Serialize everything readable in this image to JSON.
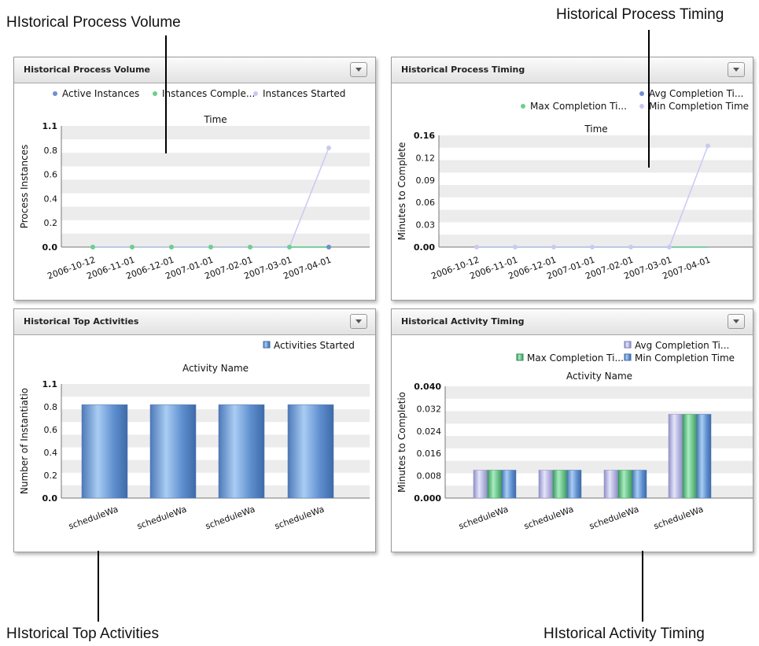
{
  "callouts": {
    "volume": "HIstorical Process Volume",
    "timing": "Historical Process Timing",
    "top_activities": "HIstorical Top Activities",
    "activity_timing": "HIstorical Activity Timing"
  },
  "panels": {
    "volume": {
      "title": "Historical Process Volume",
      "legend": [
        "Active Instances",
        "Instances Comple...",
        "Instances Started"
      ]
    },
    "timing": {
      "title": "Historical Process Timing",
      "legend": [
        "Avg Completion Ti...",
        "Max Completion Ti...",
        "Min Completion Time"
      ]
    },
    "top": {
      "title": "Historical Top Activities",
      "legend": [
        "Activities Started"
      ]
    },
    "acttiming": {
      "title": "Historical Activity Timing",
      "legend": [
        "Avg Completion Ti...",
        "Max Completion Ti...",
        "Min Completion Time"
      ]
    }
  },
  "chart_data": [
    {
      "type": "line",
      "title": "Time",
      "xlabel": "",
      "ylabel": "Process Instances",
      "x": [
        "2006-10-12",
        "2006-11-01",
        "2006-12-01",
        "2007-01-01",
        "2007-02-01",
        "2007-03-01",
        "2007-04-01"
      ],
      "ylim": [
        0,
        1.1
      ],
      "yticks": [
        "0.0",
        "0.2",
        "0.4",
        "0.6",
        "0.8",
        "1.1"
      ],
      "series": [
        {
          "name": "Active Instances",
          "color": "#6f8fd0",
          "values": [
            0,
            0,
            0,
            0,
            0,
            0,
            0
          ]
        },
        {
          "name": "Instances Comple...",
          "color": "#6ccf8e",
          "values": [
            0,
            0,
            0,
            0,
            0,
            0,
            0
          ]
        },
        {
          "name": "Instances Started",
          "color": "#c9c9f2",
          "values": [
            0,
            0,
            0,
            0,
            0,
            0,
            0.9
          ]
        }
      ]
    },
    {
      "type": "line",
      "title": "Time",
      "xlabel": "",
      "ylabel": "Minutes to Complete",
      "x": [
        "2006-10-12",
        "2006-11-01",
        "2006-12-01",
        "2007-01-01",
        "2007-02-01",
        "2007-03-01",
        "2007-04-01"
      ],
      "ylim": [
        0,
        0.16
      ],
      "yticks": [
        "0.00",
        "0.03",
        "0.06",
        "0.09",
        "0.12",
        "0.16"
      ],
      "series": [
        {
          "name": "Avg Completion Ti...",
          "color": "#6f8fd0",
          "values": [
            0,
            0,
            0,
            0,
            0,
            0,
            0
          ]
        },
        {
          "name": "Max Completion Ti...",
          "color": "#6ccf8e",
          "values": [
            0,
            0,
            0,
            0,
            0,
            0,
            0
          ]
        },
        {
          "name": "Min Completion Time",
          "color": "#c9c9f2",
          "values": [
            0,
            0,
            0,
            0,
            0,
            0,
            0.145
          ]
        }
      ]
    },
    {
      "type": "bar",
      "title": "Activity Name",
      "xlabel": "",
      "ylabel": "Number of Instantiatio",
      "categories": [
        "scheduleWa",
        "scheduleWa",
        "scheduleWa",
        "scheduleWa"
      ],
      "ylim": [
        0,
        1.1
      ],
      "yticks": [
        "0.0",
        "0.2",
        "0.4",
        "0.6",
        "0.8",
        "1.1"
      ],
      "series": [
        {
          "name": "Activities Started",
          "color": "#6f9ed8",
          "values": [
            0.9,
            0.9,
            0.9,
            0.9
          ]
        }
      ]
    },
    {
      "type": "bar",
      "title": "Activity Name",
      "xlabel": "",
      "ylabel": "Minutes to Completio",
      "categories": [
        "scheduleWa",
        "scheduleWa",
        "scheduleWa",
        "scheduleWa"
      ],
      "ylim": [
        0,
        0.04
      ],
      "yticks": [
        "0.000",
        "0.008",
        "0.016",
        "0.024",
        "0.032",
        "0.040"
      ],
      "series": [
        {
          "name": "Avg Completion Ti...",
          "color": "#b8b8e0",
          "values": [
            0.01,
            0.01,
            0.01,
            0.03
          ]
        },
        {
          "name": "Max Completion Ti...",
          "color": "#6ccf8e",
          "values": [
            0.01,
            0.01,
            0.01,
            0.03
          ]
        },
        {
          "name": "Min Completion Time",
          "color": "#6f9ed8",
          "values": [
            0.01,
            0.01,
            0.01,
            0.03
          ]
        }
      ]
    }
  ]
}
